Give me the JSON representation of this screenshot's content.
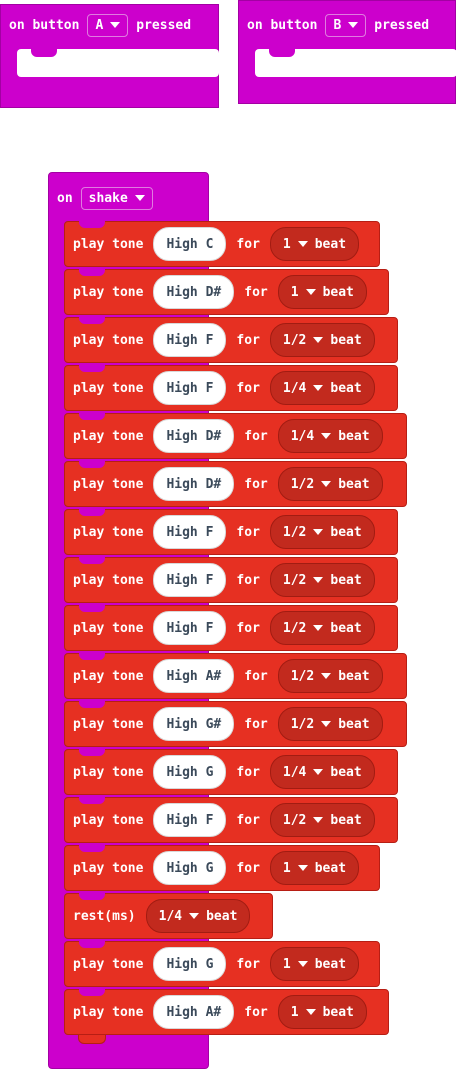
{
  "event_a": {
    "prefix": "on button",
    "button": "A",
    "suffix": "pressed"
  },
  "event_b": {
    "prefix": "on button",
    "button": "B",
    "suffix": "pressed"
  },
  "event_shake": {
    "prefix": "on",
    "gesture": "shake"
  },
  "blocks": [
    {
      "play": "play tone",
      "note": "High C",
      "for": "for",
      "dur": "1",
      "beat": "beat"
    },
    {
      "play": "play tone",
      "note": "High D#",
      "for": "for",
      "dur": "1",
      "beat": "beat"
    },
    {
      "play": "play tone",
      "note": "High F",
      "for": "for",
      "dur": "1/2",
      "beat": "beat"
    },
    {
      "play": "play tone",
      "note": "High F",
      "for": "for",
      "dur": "1/4",
      "beat": "beat"
    },
    {
      "play": "play tone",
      "note": "High D#",
      "for": "for",
      "dur": "1/4",
      "beat": "beat"
    },
    {
      "play": "play tone",
      "note": "High D#",
      "for": "for",
      "dur": "1/2",
      "beat": "beat"
    },
    {
      "play": "play tone",
      "note": "High F",
      "for": "for",
      "dur": "1/2",
      "beat": "beat"
    },
    {
      "play": "play tone",
      "note": "High F",
      "for": "for",
      "dur": "1/2",
      "beat": "beat"
    },
    {
      "play": "play tone",
      "note": "High F",
      "for": "for",
      "dur": "1/2",
      "beat": "beat"
    },
    {
      "play": "play tone",
      "note": "High A#",
      "for": "for",
      "dur": "1/2",
      "beat": "beat"
    },
    {
      "play": "play tone",
      "note": "High G#",
      "for": "for",
      "dur": "1/2",
      "beat": "beat"
    },
    {
      "play": "play tone",
      "note": "High G",
      "for": "for",
      "dur": "1/4",
      "beat": "beat"
    },
    {
      "play": "play tone",
      "note": "High F",
      "for": "for",
      "dur": "1/2",
      "beat": "beat"
    },
    {
      "play": "play tone",
      "note": "High G",
      "for": "for",
      "dur": "1",
      "beat": "beat"
    },
    {
      "rest": "rest(ms)",
      "dur": "1/4",
      "beat": "beat"
    },
    {
      "play": "play tone",
      "note": "High G",
      "for": "for",
      "dur": "1",
      "beat": "beat"
    },
    {
      "play": "play tone",
      "note": "High A#",
      "for": "for",
      "dur": "1",
      "beat": "beat"
    }
  ],
  "colors": {
    "event": "#cc00cc",
    "music": "#e63022",
    "music_dropdown": "#c22a1e"
  }
}
